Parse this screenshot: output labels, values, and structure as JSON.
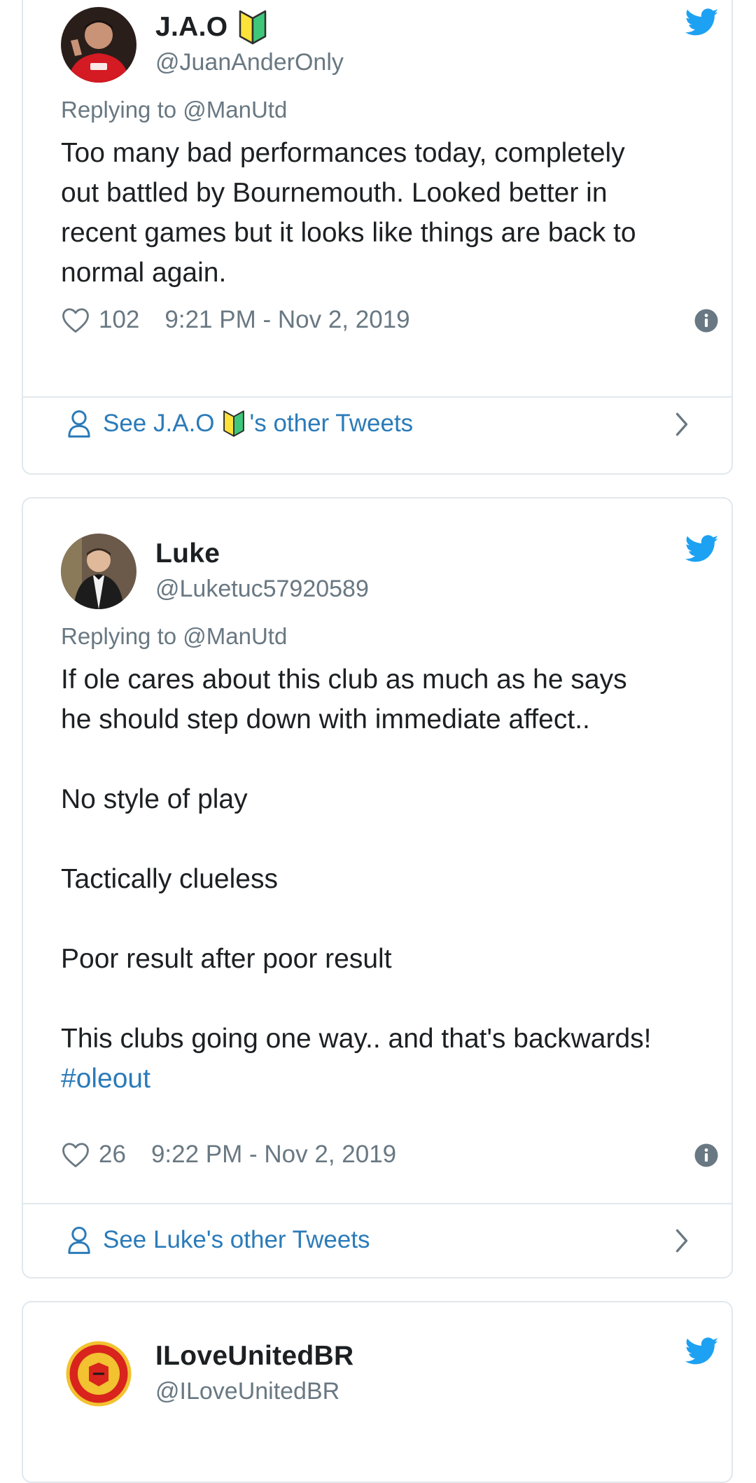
{
  "tweets": [
    {
      "display_name": "J.A.O",
      "handle": "@JuanAnderOnly",
      "has_badge": true,
      "avatar": "man-utd-player-avatar",
      "reply": "Replying to @ManUtd",
      "text": "Too many bad performances today, completely\nout battled by Bournemouth. Looked better in\nrecent games but it looks like things are back to\nnormal again.",
      "likes": "102",
      "timestamp": "9:21 PM - Nov 2, 2019",
      "see_prefix": "See J.A.O",
      "see_suffix": "'s other Tweets"
    },
    {
      "display_name": "Luke",
      "handle": "@Luketuc57920589",
      "has_badge": false,
      "avatar": "person-in-suit-avatar",
      "reply": "Replying to @ManUtd",
      "text": "If ole cares about this club as much as he says\nhe should step down with immediate affect..\n\nNo style of play\n\nTactically clueless\n\nPoor result after poor result\n\nThis clubs going one way.. and that's backwards!",
      "hashtag": "#oleout",
      "likes": "26",
      "timestamp": "9:22 PM - Nov 2, 2019",
      "see_prefix": "See Luke's other Tweets"
    },
    {
      "display_name": "ILoveUnitedBR",
      "handle": "@ILoveUnitedBR",
      "avatar": "man-utd-crest-avatar"
    }
  ],
  "colors": {
    "twitter_blue": "#1da1f2",
    "link_blue": "#2b7bb9",
    "muted_gray": "#697882",
    "text_dark": "#1c2022",
    "border": "#e1e8ed"
  },
  "icons": [
    "twitter-bird-icon",
    "heart-icon",
    "info-icon",
    "person-icon",
    "chevron-right-icon",
    "beginner-mark-icon"
  ]
}
